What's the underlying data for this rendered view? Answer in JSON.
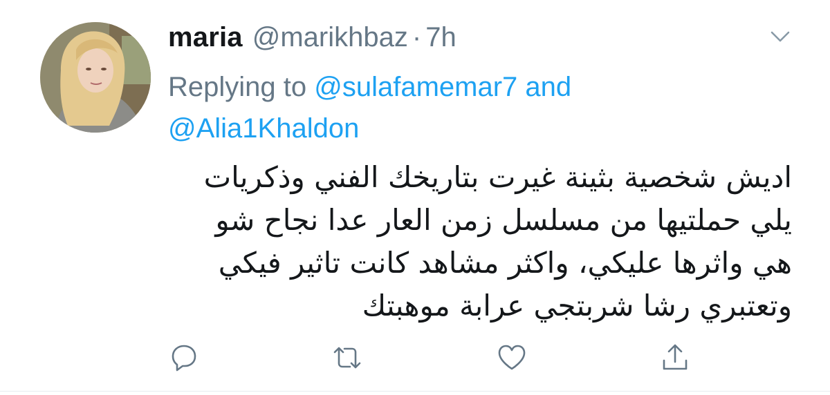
{
  "tweet": {
    "display_name": "maria",
    "handle": "@marikhbaz",
    "separator": "·",
    "time": "7h",
    "replying_prefix": "Replying to",
    "mention_1": "@sulafamemar7",
    "conjunction": "and",
    "mention_2": "@Alia1Khaldon",
    "text_lines": [
      "اديش شخصية بثينة غيرت بتاريخك الفني وذكريات",
      "يلي حملتيها من مسلسل زمن العار عدا نجاح شو",
      "هي واثرها عليكي، واكثر مشاهد كانت تاثير فيكي",
      "وتعتبري رشا شربتجي عرابة موهبتك"
    ]
  },
  "icons": {
    "more": "chevron-down-icon",
    "reply": "reply-icon",
    "retweet": "retweet-icon",
    "like": "heart-icon",
    "share": "share-icon"
  },
  "colors": {
    "text": "#14171a",
    "secondary": "#657786",
    "link": "#1da1f2",
    "icon": "#657786"
  }
}
